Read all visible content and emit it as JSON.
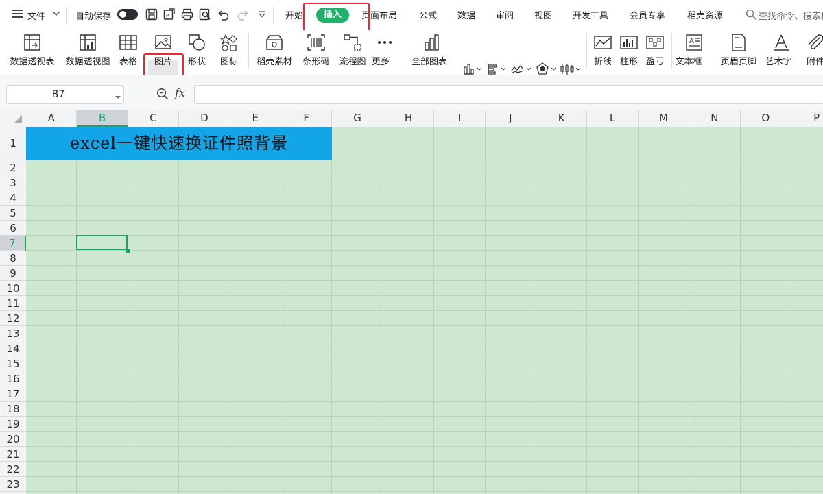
{
  "colors": {
    "accent": "#1fb06a",
    "highlight_box": "#f0262a",
    "sheet_bg": "#cde8cf",
    "title_fill": "#12a5e8"
  },
  "topbar": {
    "menu_label": "文件",
    "autosave_label": "自动保存",
    "tabs": [
      "开始",
      "插入",
      "页面布局",
      "公式",
      "数据",
      "审阅",
      "视图",
      "开发工具",
      "会员专享",
      "稻壳资源"
    ],
    "active_tab": "插入",
    "search_placeholder": "查找命令、搜索模板"
  },
  "ribbon": {
    "buttons": [
      {
        "label": "数据透视表",
        "icon": "pivot-table-icon"
      },
      {
        "label": "数据透视图",
        "icon": "pivot-chart-icon"
      },
      {
        "label": "表格",
        "icon": "table-icon"
      },
      {
        "label": "图片",
        "icon": "picture-icon",
        "dropdown": true,
        "highlighted": true
      },
      {
        "label": "形状",
        "icon": "shape-icon",
        "dropdown": true
      },
      {
        "label": "图标",
        "icon": "icons-icon",
        "dropdown": true
      },
      {
        "label": "稻壳素材",
        "icon": "material-icon"
      },
      {
        "label": "条形码",
        "icon": "barcode-icon"
      },
      {
        "label": "流程图",
        "icon": "flowchart-icon"
      },
      {
        "label": "更多",
        "icon": "more-icon",
        "dropdown": true
      },
      {
        "label": "全部图表",
        "icon": "all-charts-icon",
        "dropdown": true
      },
      {
        "label": "折线",
        "icon": "sparkline-line-icon"
      },
      {
        "label": "柱形",
        "icon": "sparkline-column-icon"
      },
      {
        "label": "盈亏",
        "icon": "sparkline-winloss-icon"
      },
      {
        "label": "文本框",
        "icon": "textbox-icon",
        "dropdown": true
      },
      {
        "label": "页眉页脚",
        "icon": "header-footer-icon"
      },
      {
        "label": "艺术字",
        "icon": "wordart-icon",
        "dropdown": true
      },
      {
        "label": "附件",
        "icon": "attachment-icon"
      }
    ]
  },
  "formula_bar": {
    "name_box": "B7",
    "fx_label": "fx",
    "formula": ""
  },
  "sheet": {
    "columns": [
      "A",
      "B",
      "C",
      "D",
      "E",
      "F",
      "G",
      "H",
      "I",
      "J",
      "K",
      "L",
      "M",
      "N",
      "O",
      "P"
    ],
    "selected_column": "B",
    "rows": [
      "1",
      "2",
      "3",
      "4",
      "5",
      "6",
      "7",
      "8",
      "9",
      "10",
      "11",
      "12",
      "13",
      "14",
      "15",
      "16",
      "17",
      "18",
      "19",
      "20",
      "21",
      "22",
      "23"
    ],
    "selected_row": "7",
    "title_cell_text": "excel一键快速换证件照背景",
    "active_cell": "B7"
  }
}
